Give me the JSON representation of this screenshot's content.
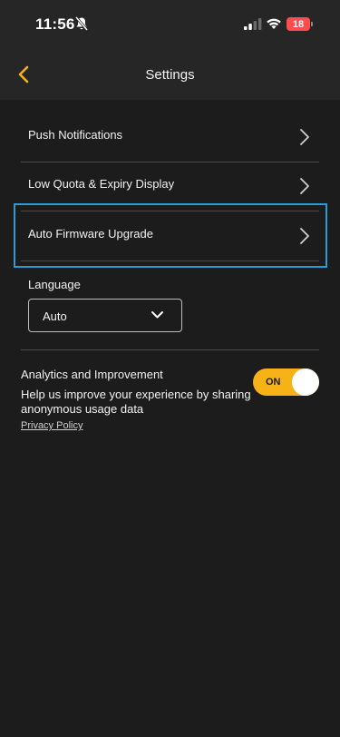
{
  "status_bar": {
    "time": "11:56",
    "battery": "18"
  },
  "header": {
    "title": "Settings"
  },
  "settings": {
    "rows": [
      {
        "label": "Push Notifications"
      },
      {
        "label": "Low Quota & Expiry Display"
      },
      {
        "label": "Auto Firmware Upgrade"
      }
    ],
    "language": {
      "label": "Language",
      "selected": "Auto"
    },
    "analytics": {
      "title": "Analytics and Improvement",
      "description": "Help us improve your experience by sharing anonymous usage data",
      "toggle_label": "ON",
      "toggle_on": true,
      "privacy_link": "Privacy Policy"
    }
  },
  "colors": {
    "accent": "#f7b218",
    "background": "#1c1c1c",
    "header_bg": "#262626",
    "highlight": "#2d9ad8",
    "battery": "#ff4d4d"
  }
}
